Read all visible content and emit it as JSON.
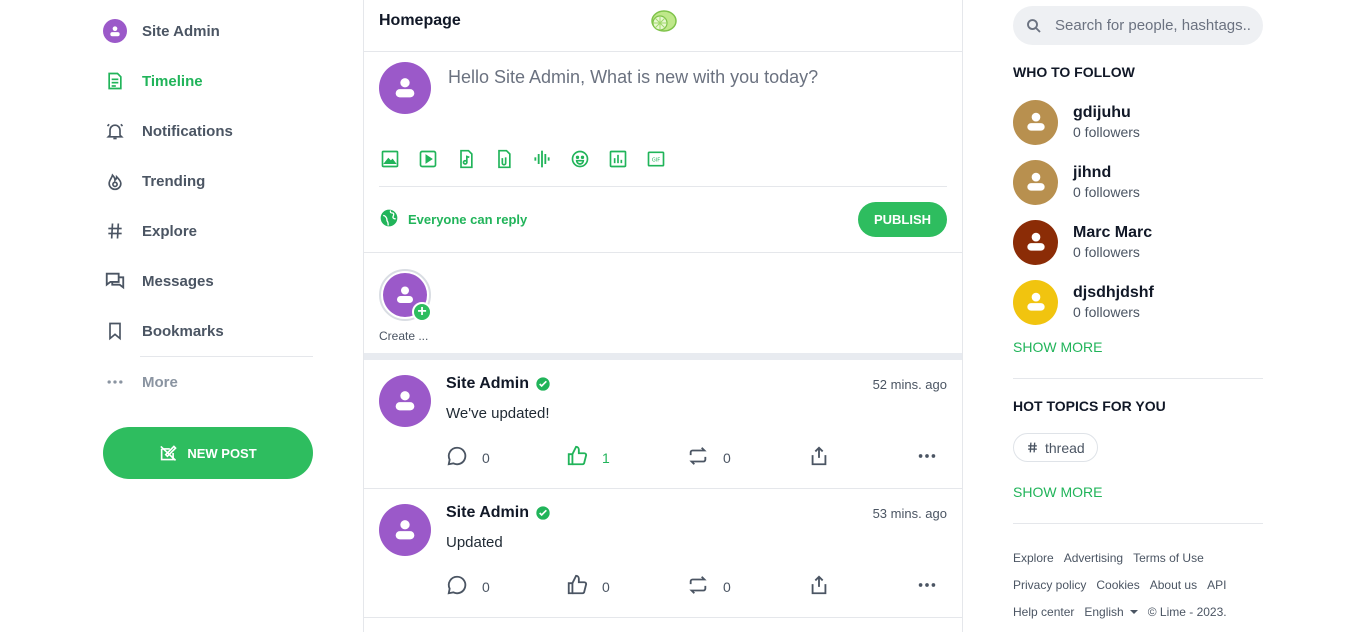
{
  "colors": {
    "accent": "#2ebd5f",
    "avatar_default": "#9b59c9"
  },
  "sidebar": {
    "items": [
      {
        "label": "Site Admin",
        "icon": "user-avatar"
      },
      {
        "label": "Timeline",
        "icon": "timeline-icon",
        "active": true
      },
      {
        "label": "Notifications",
        "icon": "bell-icon"
      },
      {
        "label": "Trending",
        "icon": "flame-icon"
      },
      {
        "label": "Explore",
        "icon": "hash-icon"
      },
      {
        "label": "Messages",
        "icon": "messages-icon"
      },
      {
        "label": "Bookmarks",
        "icon": "bookmark-icon"
      },
      {
        "label": "More",
        "icon": "more-dots-icon"
      }
    ],
    "new_post_label": "NEW POST"
  },
  "header": {
    "title": "Homepage",
    "logo": "lime-logo"
  },
  "composer": {
    "placeholder": "Hello Site Admin, What is new with you today?",
    "tools": [
      "image-icon",
      "video-icon",
      "music-icon",
      "document-icon",
      "voice-icon",
      "emoji-icon",
      "poll-icon",
      "gif-icon"
    ],
    "reply_setting": "Everyone can reply",
    "publish_label": "PUBLISH"
  },
  "stories": {
    "create_label": "Create ..."
  },
  "posts": [
    {
      "author": "Site Admin",
      "verified": true,
      "time": "52 mins. ago",
      "text": "We've updated!",
      "comments": "0",
      "likes": "1",
      "liked": true,
      "reposts": "0"
    },
    {
      "author": "Site Admin",
      "verified": true,
      "time": "53 mins. ago",
      "text": "Updated",
      "comments": "0",
      "likes": "0",
      "liked": false,
      "reposts": "0"
    }
  ],
  "right": {
    "search_placeholder": "Search for people, hashtags..",
    "who_to_follow_title": "WHO TO FOLLOW",
    "follow": [
      {
        "name": "gdijuhu",
        "followers": "0 followers",
        "color": "#b8904f"
      },
      {
        "name": "jihnd",
        "followers": "0 followers",
        "color": "#b8904f"
      },
      {
        "name": "Marc Marc",
        "followers": "0 followers",
        "color": "#8b2c06"
      },
      {
        "name": "djsdhjdshf",
        "followers": "0 followers",
        "color": "#f1c40f"
      }
    ],
    "show_more_label": "SHOW MORE",
    "hot_topics_title": "HOT TOPICS FOR YOU",
    "topics": [
      "thread"
    ],
    "footer": {
      "links": [
        "Explore",
        "Advertising",
        "Terms of Use",
        "Privacy policy",
        "Cookies",
        "About us",
        "API",
        "Help center"
      ],
      "language": "English",
      "copyright": "© Lime - 2023."
    }
  }
}
